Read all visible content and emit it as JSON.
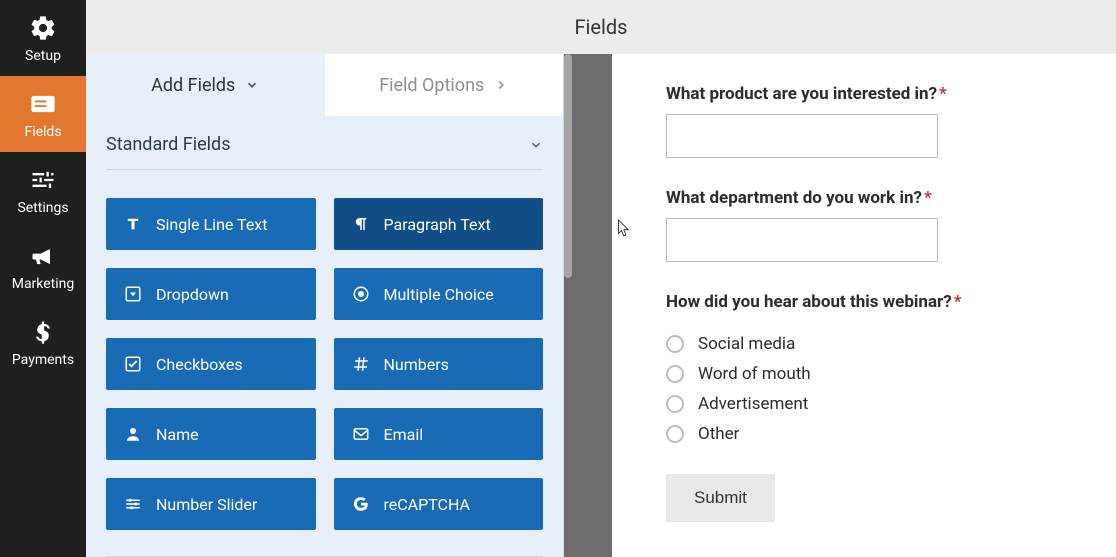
{
  "sidenav": {
    "items": [
      {
        "id": "setup",
        "label": "Setup",
        "icon": "gear-icon"
      },
      {
        "id": "fields",
        "label": "Fields",
        "icon": "form-icon",
        "active": true
      },
      {
        "id": "settings",
        "label": "Settings",
        "icon": "sliders-icon"
      },
      {
        "id": "marketing",
        "label": "Marketing",
        "icon": "bullhorn-icon"
      },
      {
        "id": "payments",
        "label": "Payments",
        "icon": "dollar-icon"
      }
    ]
  },
  "header": {
    "title": "Fields"
  },
  "tabs": {
    "add": {
      "label": "Add Fields"
    },
    "opts": {
      "label": "Field Options"
    }
  },
  "sections": {
    "standard": {
      "title": "Standard Fields",
      "fields": [
        {
          "label": "Single Line Text",
          "icon": "text-icon"
        },
        {
          "label": "Paragraph Text",
          "icon": "paragraph-icon",
          "hover": true
        },
        {
          "label": "Dropdown",
          "icon": "caret-square-icon"
        },
        {
          "label": "Multiple Choice",
          "icon": "dot-circle-icon"
        },
        {
          "label": "Checkboxes",
          "icon": "check-square-icon"
        },
        {
          "label": "Numbers",
          "icon": "hash-icon"
        },
        {
          "label": "Name",
          "icon": "user-icon"
        },
        {
          "label": "Email",
          "icon": "envelope-icon"
        },
        {
          "label": "Number Slider",
          "icon": "sliders-h-icon"
        },
        {
          "label": "reCAPTCHA",
          "icon": "google-icon"
        }
      ]
    }
  },
  "preview": {
    "q1": {
      "label": "What product are you interested in?",
      "required": true
    },
    "q2": {
      "label": "What department do you work in?",
      "required": true
    },
    "q3": {
      "label": "How did you hear about this webinar?",
      "required": true,
      "options": [
        "Social media",
        "Word of mouth",
        "Advertisement",
        "Other"
      ]
    },
    "submit_label": "Submit"
  },
  "required_mark": "*"
}
